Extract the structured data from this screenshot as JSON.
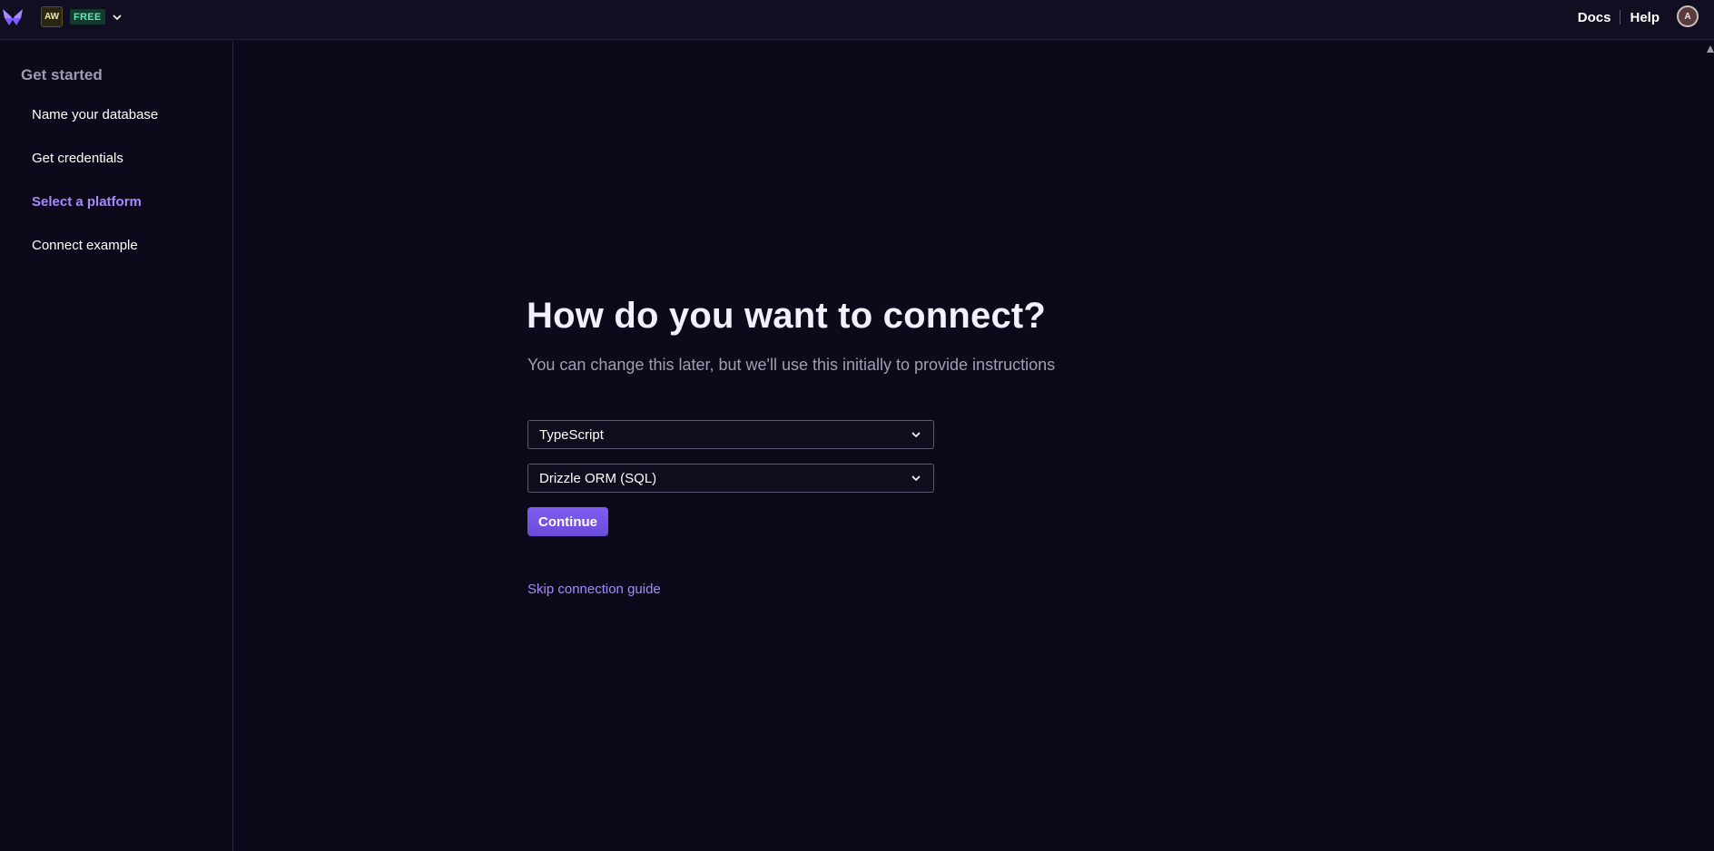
{
  "topbar": {
    "team_initials": "AW",
    "plan_label": "FREE",
    "docs_label": "Docs",
    "help_label": "Help",
    "avatar_initial": "A",
    "colors": {
      "logo": "#a78bfa",
      "plan_text": "#5ee8b3",
      "plan_bg": "#143a30"
    }
  },
  "sidebar": {
    "heading": "Get started",
    "items": [
      {
        "label": "Name your database",
        "active": false
      },
      {
        "label": "Get credentials",
        "active": false
      },
      {
        "label": "Select a platform",
        "active": true
      },
      {
        "label": "Connect example",
        "active": false
      }
    ]
  },
  "main": {
    "title": "How do you want to connect?",
    "subtitle": "You can change this later, but we'll use this initially to provide instructions",
    "language_select": {
      "value": "TypeScript"
    },
    "framework_select": {
      "value": "Drizzle ORM (SQL)"
    },
    "continue_label": "Continue",
    "skip_label": "Skip connection guide",
    "colors": {
      "accent": "#a78bfa",
      "button": "#7c5cff",
      "background": "#0c0a1a"
    }
  },
  "icons": {
    "logo": "butterfly-logo-icon",
    "team_chevron": "chevron-down-icon",
    "select_chevron": "chevron-down-icon"
  }
}
